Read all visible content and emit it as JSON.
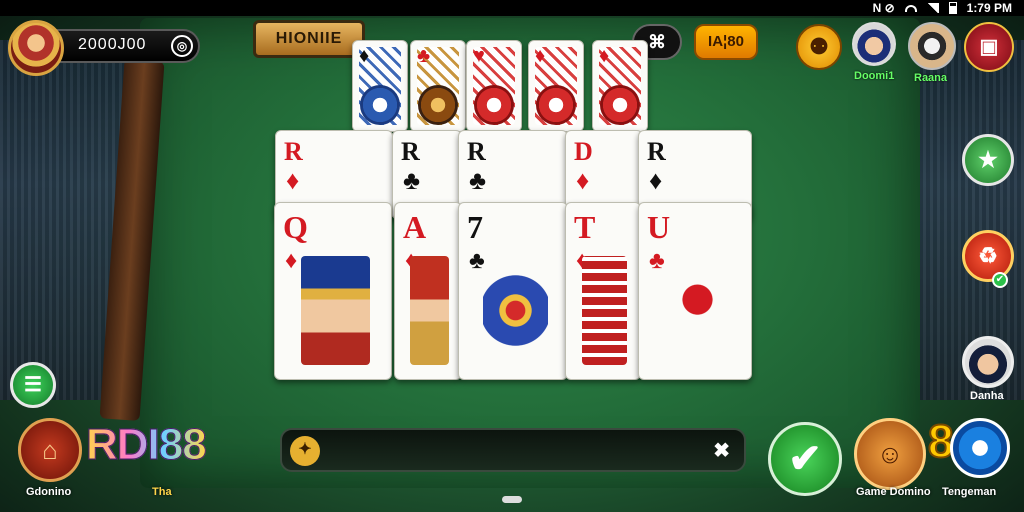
{
  "status_bar": {
    "left_icons": "N ⊘",
    "time": "1:79 PM"
  },
  "player": {
    "balance": "2000J00",
    "menu_glyph": "◎"
  },
  "top": {
    "banner_label": "HIONIIE",
    "dark_button_glyph": "⌘",
    "orange_button_label": "IA¦80",
    "red_button_glyph": "▣"
  },
  "opponents": [
    {
      "name": "Doomi1"
    },
    {
      "name": "Raana"
    },
    {
      "name": "Danha"
    }
  ],
  "top_row_cards": [
    {
      "style": "blue",
      "suit": "♦"
    },
    {
      "style": "gold",
      "suit": "♣"
    },
    {
      "style": "red",
      "suit": "♥"
    },
    {
      "style": "red",
      "suit": "♦"
    },
    {
      "style": "red",
      "suit": "♦"
    }
  ],
  "middle_row_cards": [
    {
      "rank": "R",
      "suit": "♦",
      "color": "red"
    },
    {
      "rank": "R",
      "suit": "♣",
      "color": "black"
    },
    {
      "rank": "R",
      "suit": "♣",
      "color": "black"
    },
    {
      "rank": "D",
      "suit": "♦",
      "color": "red"
    },
    {
      "rank": "R",
      "suit": "♦",
      "color": "black"
    }
  ],
  "front_row_cards": [
    {
      "rank": "Q",
      "suit": "♦",
      "color": "red"
    },
    {
      "rank": "A",
      "suit": "♦",
      "color": "red"
    },
    {
      "rank": "7",
      "suit": "♣",
      "color": "black"
    },
    {
      "rank": "T",
      "suit": "♦",
      "color": "red"
    },
    {
      "rank": "U",
      "suit": "♣",
      "color": "red"
    }
  ],
  "side_buttons": {
    "left_green_glyph": "☰",
    "left_red_glyph": "⌂",
    "right_green_glyph": "★",
    "right_red_glyph": "♻",
    "right_red_badge": "✔"
  },
  "bottom": {
    "left_label": "Gdonino",
    "logo_text": "RDI88",
    "logo_sub": "Tha",
    "chat_emoji": "✦",
    "chat_close": "✖",
    "check_glyph": "✔",
    "game_domino_label": "Game Domino",
    "game_domino_glyph": "☺",
    "big_digit": "8",
    "right_label": "Tengeman"
  },
  "colors": {
    "felt": "#236e3a",
    "accent_gold": "#e6b560",
    "red_suit": "#d41a22"
  }
}
